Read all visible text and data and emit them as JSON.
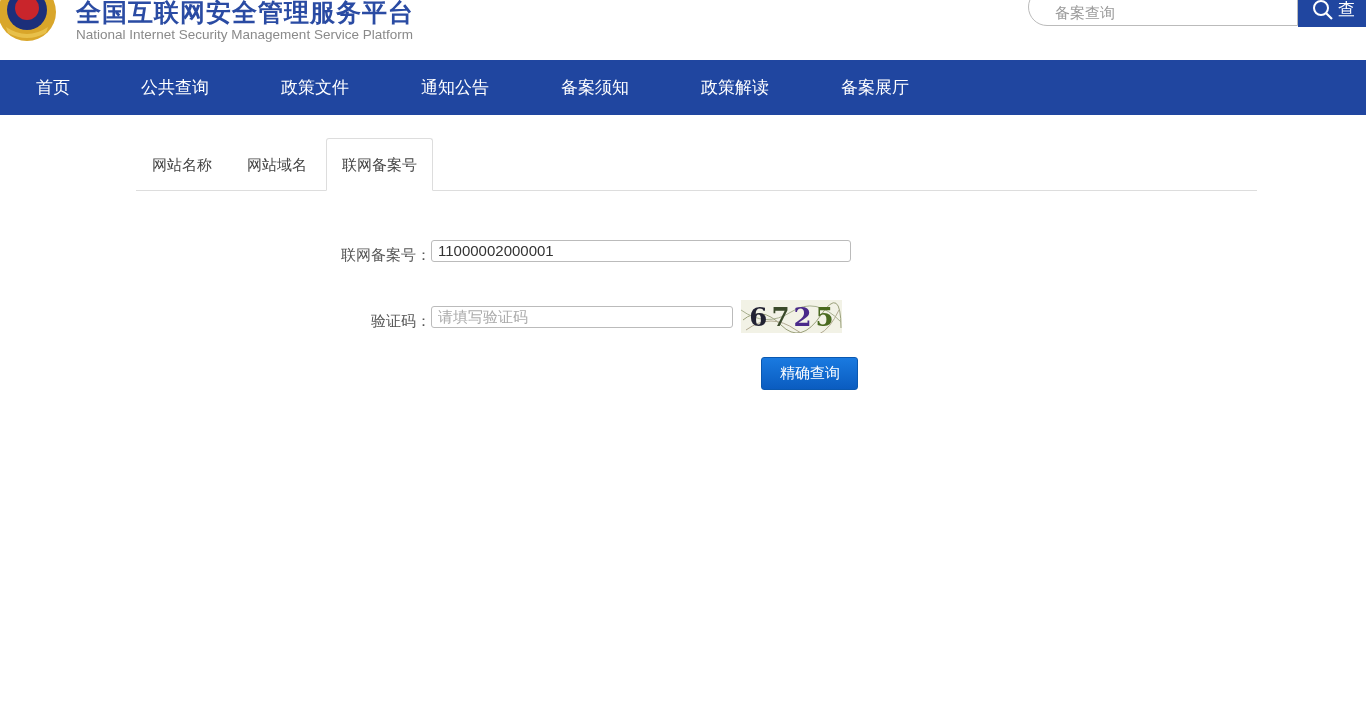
{
  "header": {
    "title": "全国互联网安全管理服务平台",
    "subtitle": "National Internet Security Management Service Platform",
    "search": {
      "placeholder": "备案查询",
      "button": "查"
    }
  },
  "nav": [
    {
      "label": "首页"
    },
    {
      "label": "公共查询"
    },
    {
      "label": "政策文件"
    },
    {
      "label": "通知公告"
    },
    {
      "label": "备案须知"
    },
    {
      "label": "政策解读"
    },
    {
      "label": "备案展厅"
    }
  ],
  "tabs": [
    {
      "label": "网站名称",
      "selected": false
    },
    {
      "label": "网站域名",
      "selected": false
    },
    {
      "label": "联网备案号",
      "selected": true
    }
  ],
  "form": {
    "record_label": "联网备案号：",
    "record_value": "11000002000001",
    "captcha_label": "验证码：",
    "captcha_placeholder": "请填写验证码",
    "captcha": [
      {
        "text": "6",
        "color": "#222233"
      },
      {
        "text": "7",
        "color": "#3a4a2a"
      },
      {
        "text": "2",
        "color": "#4a2a8a"
      },
      {
        "text": "5",
        "color": "#4a6a20"
      }
    ],
    "submit": "精确查询"
  }
}
